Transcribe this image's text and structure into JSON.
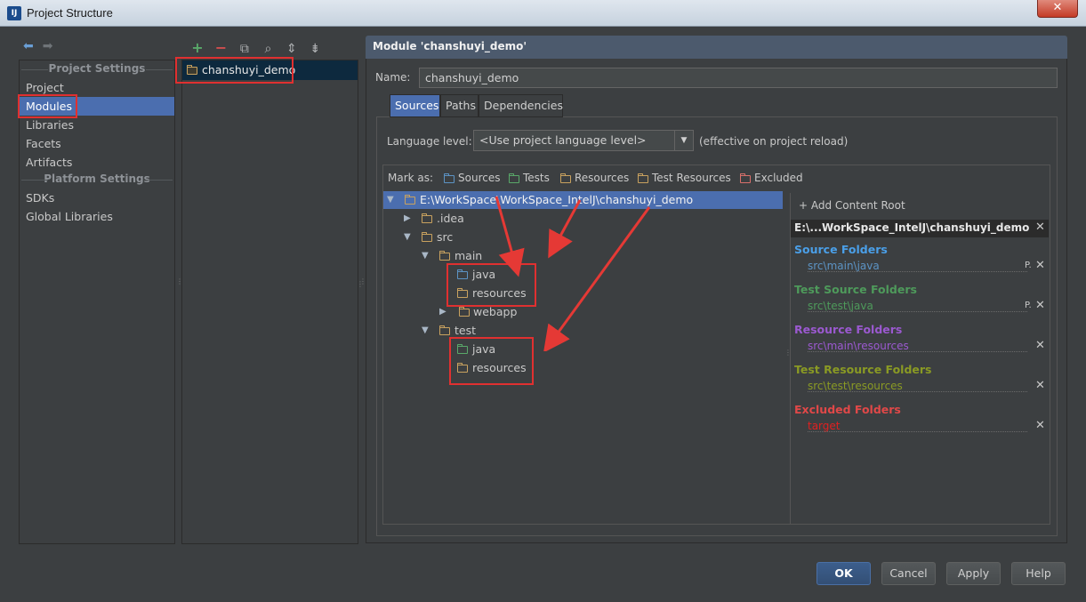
{
  "window": {
    "title": "Project Structure",
    "app_icon": "IJ",
    "close": "✕"
  },
  "nav": {
    "back": "back-arrow-icon",
    "forward": "forward-arrow-icon",
    "project_settings_header": "Project Settings",
    "project_items": [
      "Project",
      "Modules",
      "Libraries",
      "Facets",
      "Artifacts"
    ],
    "platform_settings_header": "Platform Settings",
    "platform_items": [
      "SDKs",
      "Global Libraries"
    ],
    "selected": "Modules"
  },
  "module_toolbar": {
    "add": "+",
    "remove": "−",
    "copy": "⧉",
    "find": "⌕",
    "expand": "⇕",
    "collapse": "⇟"
  },
  "modules": [
    "chanshuyi_demo"
  ],
  "module_panel": {
    "header": "Module 'chanshuyi_demo'",
    "name_label": "Name:",
    "name_value": "chanshuyi_demo",
    "tabs": [
      "Sources",
      "Paths",
      "Dependencies"
    ],
    "active_tab": "Sources",
    "language_label": "Language level:",
    "language_value": "<Use project language level>",
    "language_note": "(effective on project reload)",
    "mark_as_label": "Mark as:",
    "mark_as": [
      {
        "label": "Sources",
        "color": "#5c93c4"
      },
      {
        "label": "Tests",
        "color": "#59a869"
      },
      {
        "label": "Resources",
        "color": "#c9a25f"
      },
      {
        "label": "Test Resources",
        "color": "#c9a25f"
      },
      {
        "label": "Excluded",
        "color": "#d9706b"
      }
    ]
  },
  "tree": [
    {
      "label": "E:\\WorkSpace\\WorkSpace_IntelJ\\chanshuyi_demo",
      "depth": 0,
      "arrow": "▼",
      "color": "#c9a25f",
      "selected": true
    },
    {
      "label": ".idea",
      "depth": 1,
      "arrow": "▶",
      "color": "#c9a25f"
    },
    {
      "label": "src",
      "depth": 1,
      "arrow": "▼",
      "color": "#c9a25f"
    },
    {
      "label": "main",
      "depth": 2,
      "arrow": "▼",
      "color": "#c9a25f"
    },
    {
      "label": "java",
      "depth": 3,
      "arrow": "",
      "color": "#5c93c4"
    },
    {
      "label": "resources",
      "depth": 3,
      "arrow": "",
      "color": "#c9a25f"
    },
    {
      "label": "webapp",
      "depth": 3,
      "arrow": "▶",
      "color": "#c9a25f"
    },
    {
      "label": "test",
      "depth": 2,
      "arrow": "▼",
      "color": "#c9a25f"
    },
    {
      "label": "java",
      "depth": 3,
      "arrow": "",
      "color": "#59a869"
    },
    {
      "label": "resources",
      "depth": 3,
      "arrow": "",
      "color": "#c9a25f"
    }
  ],
  "content_roots": {
    "add_label": "+ Add Content Root",
    "root": "E:\\...WorkSpace_IntelJ\\chanshuyi_demo",
    "categories": [
      {
        "title": "Source Folders",
        "title_color": "#4a9fe8",
        "path": "src\\main\\java",
        "path_color": "#5c93c4",
        "props": true
      },
      {
        "title": "Test Source Folders",
        "title_color": "#4e9a5b",
        "path": "src\\test\\java",
        "path_color": "#4e9a5b",
        "props": true
      },
      {
        "title": "Resource Folders",
        "title_color": "#9b59d0",
        "path": "src\\main\\resources",
        "path_color": "#9b59d0",
        "props": false
      },
      {
        "title": "Test Resource Folders",
        "title_color": "#8a9a24",
        "path": "src\\test\\resources",
        "path_color": "#8a9a24",
        "props": false
      },
      {
        "title": "Excluded Folders",
        "title_color": "#e04848",
        "path": "target",
        "path_color": "#e02020",
        "props": false
      }
    ]
  },
  "buttons": {
    "ok": "OK",
    "cancel": "Cancel",
    "apply": "Apply",
    "help": "Help"
  }
}
